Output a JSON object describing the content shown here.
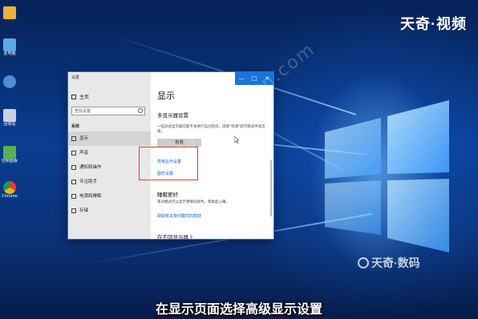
{
  "brand": {
    "top": "天奇·视频",
    "bottom": "天奇·数码",
    "watermark": "shuma.tianqijun.com"
  },
  "desktop_icons": [
    {
      "label": "",
      "icon": "folder-user-icon",
      "color": "#e8b23c"
    },
    {
      "label": "此电脑",
      "icon": "computer-icon",
      "color": "#5aa9e6"
    },
    {
      "label": "",
      "icon": "network-icon",
      "color": "#4b8fd8"
    },
    {
      "label": "回收站",
      "icon": "recycle-bin-icon",
      "color": "#c9d3e0"
    },
    {
      "label": "控制面板",
      "icon": "control-panel-icon",
      "color": "#58b24f"
    },
    {
      "label": "Chrome",
      "icon": "chrome-icon",
      "color": "#db4437"
    }
  ],
  "settings_window": {
    "app_title": "设置",
    "home_label": "主页",
    "search_placeholder": "查找设置",
    "section": "系统",
    "nav": [
      {
        "label": "显示",
        "active": true
      },
      {
        "label": "声音",
        "active": false
      },
      {
        "label": "通知和操作",
        "active": false
      },
      {
        "label": "专注助手",
        "active": false
      },
      {
        "label": "电源和睡眠",
        "active": false
      },
      {
        "label": "存储",
        "active": false
      }
    ],
    "title_buttons": [
      "—",
      "□",
      "✕"
    ],
    "page_title": "显示",
    "multi_display_heading": "多显示器设置",
    "multi_display_text": "一些旧式显示器可能不会进行自动连接，选择\"检测\"即可尝试手动连接。",
    "detect_button": "检测",
    "advanced_link": "高级显示设置",
    "graphics_link": "图形设置",
    "sleep_heading": "睡眠更好",
    "sleep_text": "夜间模式可以显示更暖的颜色，帮助您入睡。",
    "sleep_link": "获取有关夜间模式的帮助",
    "bottom_heading": "在不同显示器上"
  },
  "subtitle": "在显示页面选择高级显示设置"
}
